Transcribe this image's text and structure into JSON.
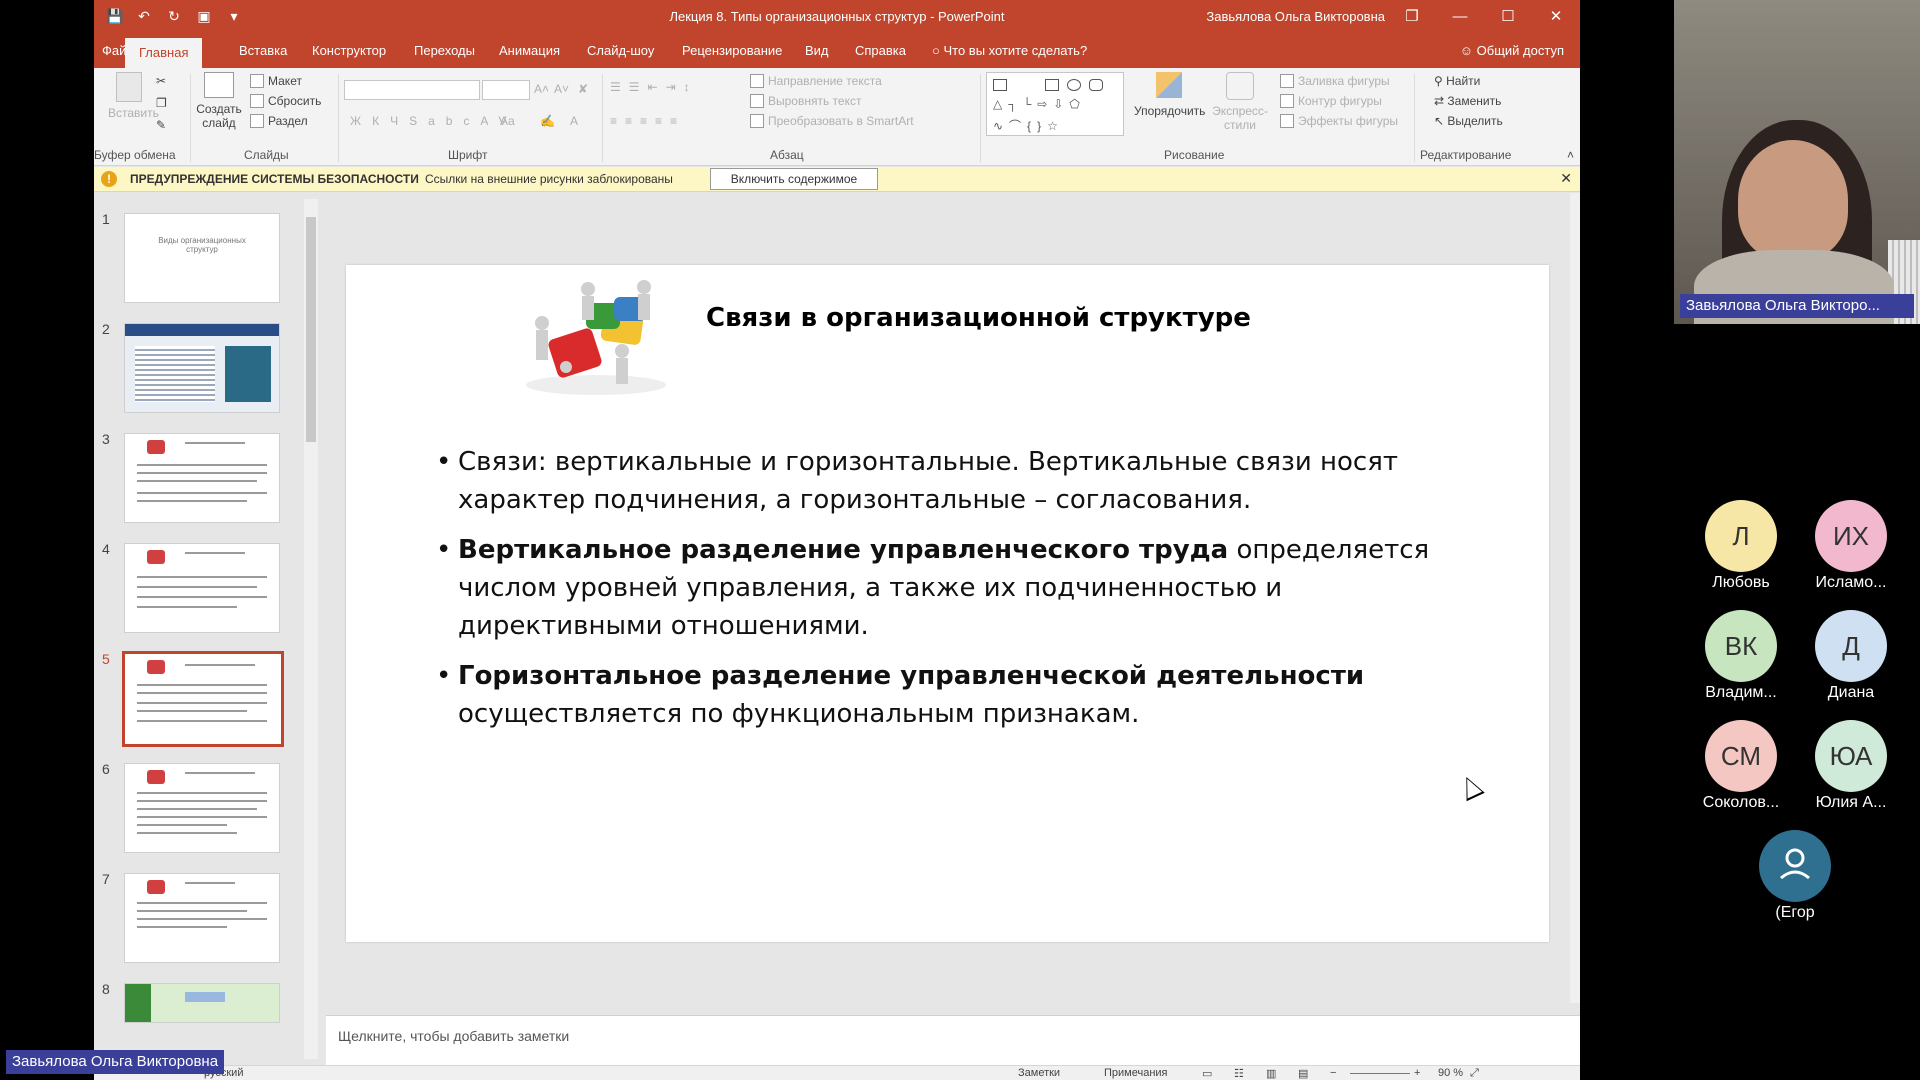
{
  "window": {
    "title": "Лекция 8. Типы организационных структур  -  PowerPoint",
    "user": "Завьялова Ольга Викторовна"
  },
  "menu": {
    "tabs": [
      "Файл",
      "Главная",
      "Вставка",
      "Конструктор",
      "Переходы",
      "Анимация",
      "Слайд-шоу",
      "Рецензирование",
      "Вид",
      "Справка"
    ],
    "tell_me": "Что вы хотите сделать?",
    "share": "Общий доступ"
  },
  "ribbon": {
    "clipboard": {
      "paste": "Вставить",
      "group": "Буфер обмена"
    },
    "slides": {
      "new_slide": "Создать слайд",
      "layout": "Макет",
      "reset": "Сбросить",
      "section": "Раздел",
      "group": "Слайды"
    },
    "font": {
      "group": "Шрифт"
    },
    "paragraph": {
      "text_direction": "Направление текста",
      "align_text": "Выровнять текст",
      "smartart": "Преобразовать в SmartArt",
      "group": "Абзац"
    },
    "drawing": {
      "arrange": "Упорядочить",
      "quick_styles": "Экспресс-стили",
      "shape_fill": "Заливка фигуры",
      "shape_outline": "Контур фигуры",
      "shape_effects": "Эффекты фигуры",
      "group": "Рисование"
    },
    "editing": {
      "find": "Найти",
      "replace": "Заменить",
      "select": "Выделить",
      "group": "Редактирование"
    }
  },
  "security_bar": {
    "title": "ПРЕДУПРЕЖДЕНИЕ СИСТЕМЫ БЕЗОПАСНОСТИ",
    "message": "Ссылки на внешние рисунки заблокированы",
    "button": "Включить содержимое"
  },
  "thumbnails": {
    "numbers": [
      "1",
      "2",
      "3",
      "4",
      "5",
      "6",
      "7",
      "8"
    ],
    "slide1_title": "Виды организационных структур",
    "active": "5"
  },
  "slide": {
    "title": "Связи в организационной структуре",
    "bullet1": "Связи: вертикальные и горизонтальные. Вертикальные связи носят характер подчинения, а горизонтальные – согласования.",
    "bullet2_bold": "Вертикальное разделение управленческого труда",
    "bullet2_rest": " определяется числом уровней управления, а также их подчиненностью и директивными отношениями.",
    "bullet3_bold": " Горизонтальное разделение управленческой деятельности",
    "bullet3_rest": "осуществляется по функциональным признакам."
  },
  "notes": {
    "placeholder": "Щелкните, чтобы добавить заметки"
  },
  "status": {
    "language": "русский",
    "notes": "Заметки",
    "comments": "Примечания",
    "zoom": "90 %"
  },
  "conference": {
    "presenter_label": "Завьялова Ольга Викторовна",
    "video_name": "Завьялова Ольга Викторо...",
    "participants": [
      {
        "initials": "Л",
        "name": "Любовь",
        "color": "#f6e7a6"
      },
      {
        "initials": "ИХ",
        "name": "Исламо...",
        "color": "#f2b8cd"
      },
      {
        "initials": "ВК",
        "name": "Владим...",
        "color": "#c7e6c0"
      },
      {
        "initials": "Д",
        "name": "Диана",
        "color": "#cfe0f3"
      },
      {
        "initials": "СМ",
        "name": "Соколов...",
        "color": "#f5c7c2"
      },
      {
        "initials": "ЮА",
        "name": "Юлия А...",
        "color": "#cfead9"
      },
      {
        "initials": "",
        "name": "(Егор",
        "color": "#2f6f8f"
      }
    ]
  }
}
